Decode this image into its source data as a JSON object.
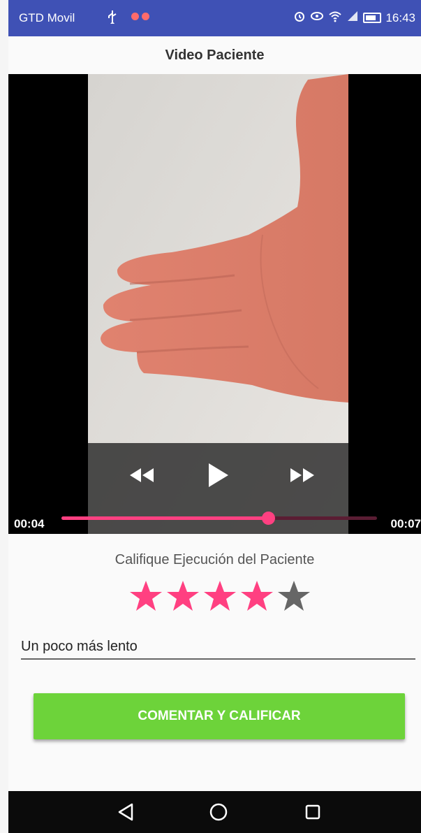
{
  "status_bar": {
    "carrier": "GTD Movil",
    "time": "16:43"
  },
  "app_bar": {
    "title": "Video Paciente"
  },
  "video_player": {
    "elapsed": "00:04",
    "duration": "00:07",
    "progress_fraction": 0.655
  },
  "rating": {
    "title": "Califique Ejecución del Paciente",
    "value": 4,
    "max": 5,
    "filled_color": "#ff4081",
    "empty_color": "#666666"
  },
  "comment": {
    "value": "Un poco más lento"
  },
  "submit_button": {
    "label": "COMENTAR Y CALIFICAR",
    "color": "#6dd33a"
  },
  "icons": {
    "status": [
      "usb-icon",
      "notification-dot-icon",
      "alarm-icon",
      "eye-icon",
      "wifi-icon",
      "signal-icon",
      "battery-icon"
    ],
    "player": [
      "rewind-icon",
      "play-icon",
      "fast-forward-icon"
    ],
    "nav": [
      "back-icon",
      "home-icon",
      "recents-icon"
    ]
  }
}
